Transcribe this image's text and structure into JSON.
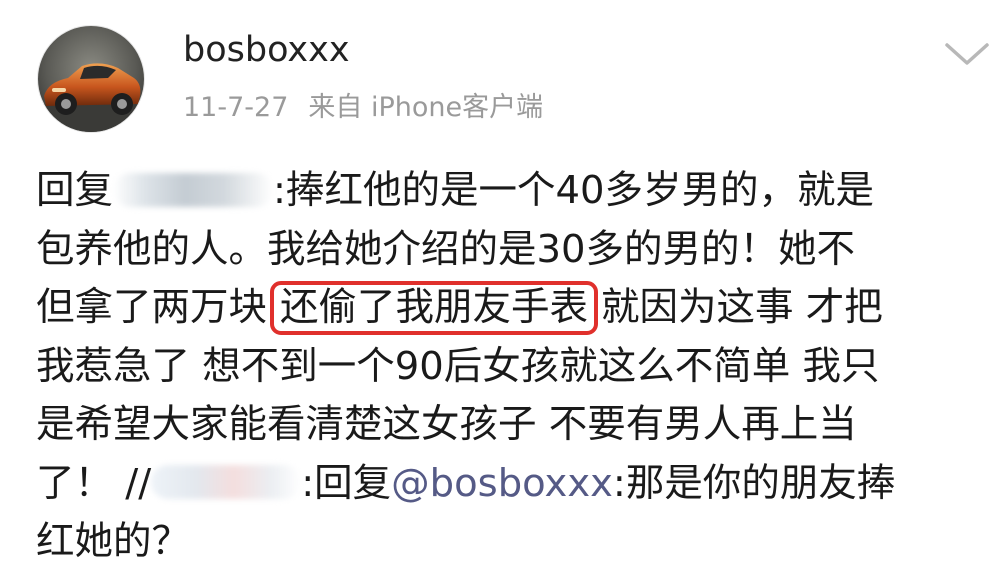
{
  "user": {
    "name": "bosboxxx",
    "avatar_icon": "sports-car-avatar"
  },
  "meta": {
    "time": "11-7-27",
    "source": "来自 iPhone客户端"
  },
  "actions": {
    "menu_icon": "chevron-down-icon"
  },
  "post": {
    "line1_prefix": "回复",
    "line1_text": ":捧红他的是一个40多岁男的，就是",
    "line2": "包养他的人。我给她介绍的是30多的男的！她不",
    "line3_before": "但拿了两万块",
    "line3_highlight": "还偷了我朋友手表",
    "line3_after": "就因为这事 才把",
    "line4": "我惹急了 想不到一个90后女孩就这么不简单 我只",
    "line5": "是希望大家能看清楚这女孩子 不要有男人再上当",
    "line6_prefix": "了！ //",
    "line6_reply": ":回复",
    "line6_mention": "@bosboxxx",
    "line6_after": ":那是你的朋友捧",
    "line7": "红她的？"
  },
  "colors": {
    "highlight_border": "#e0302c",
    "mention": "#555a86",
    "meta_text": "#9a9a9a"
  }
}
